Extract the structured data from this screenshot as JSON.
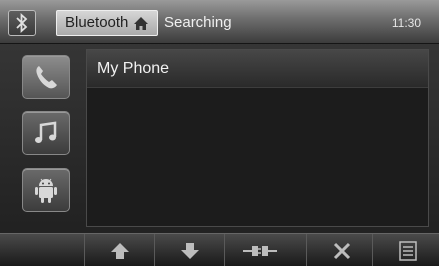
{
  "header": {
    "bt_icon": "bluetooth-icon",
    "title": "Bluetooth",
    "home_icon": "home-icon",
    "status": "Searching",
    "time": "11:30"
  },
  "sidebar": {
    "items": [
      {
        "icon": "phone-icon"
      },
      {
        "icon": "music-note-icon"
      },
      {
        "icon": "android-icon"
      }
    ]
  },
  "device_list": {
    "items": [
      {
        "label": "My Phone"
      }
    ]
  },
  "toolbar": {
    "items": [
      {
        "icon": "up-arrow-icon"
      },
      {
        "icon": "down-arrow-icon"
      },
      {
        "icon": "connect-plug-icon"
      },
      {
        "icon": "close-icon"
      },
      {
        "icon": "list-icon"
      }
    ]
  }
}
